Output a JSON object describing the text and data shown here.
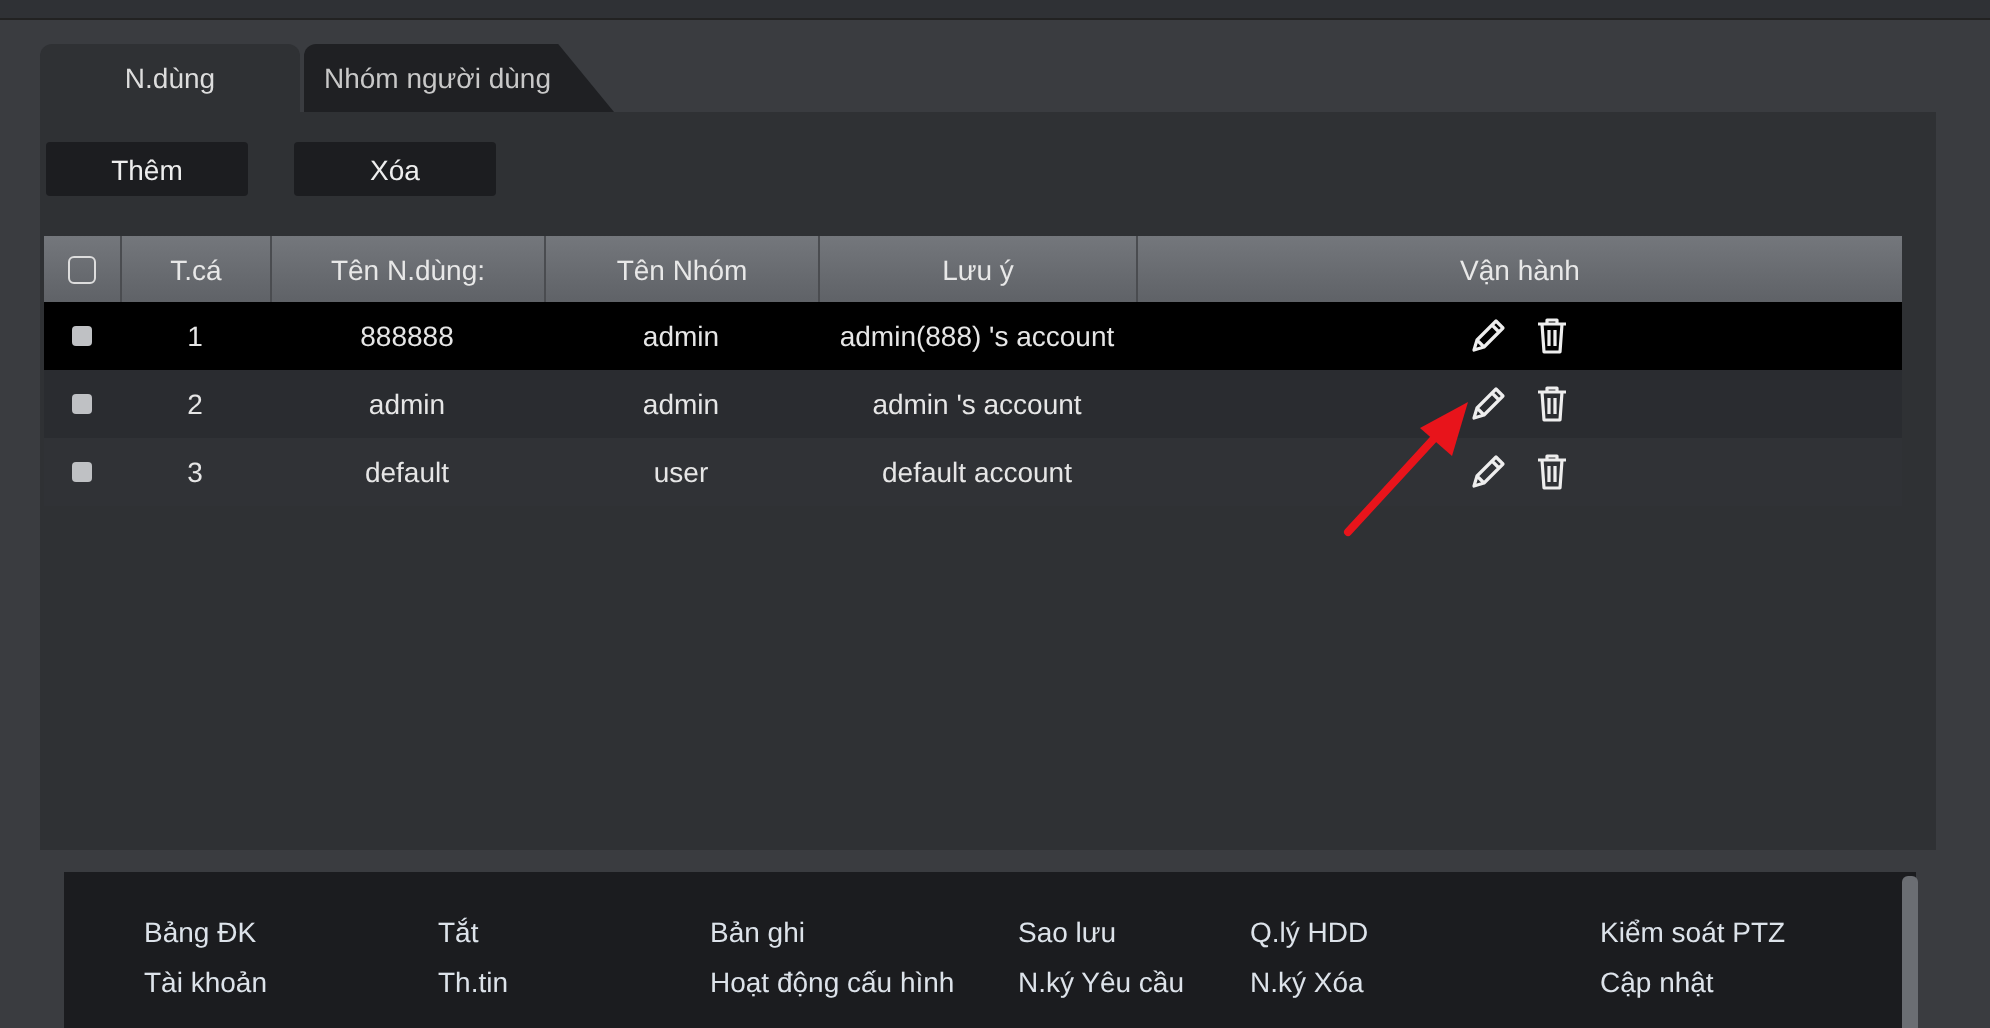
{
  "tabs": [
    {
      "label": "N.dùng",
      "selected": true
    },
    {
      "label": "Nhóm người dùng",
      "selected": false
    }
  ],
  "buttons": [
    "Thêm",
    "Xóa"
  ],
  "table": {
    "select_all": {
      "checked": false
    },
    "columns": [
      "T.cá",
      "Tên N.dùng:",
      "Tên Nhóm",
      "Lưu ý",
      "Vận hành"
    ],
    "rows": [
      {
        "checked": false,
        "selected": true,
        "cells": [
          "1",
          "888888",
          "admin",
          "admin(888) 's account"
        ]
      },
      {
        "checked": false,
        "selected": false,
        "cells": [
          "2",
          "admin",
          "admin",
          "admin 's account"
        ]
      },
      {
        "checked": false,
        "selected": false,
        "cells": [
          "3",
          "default",
          "user",
          "default account"
        ]
      }
    ]
  },
  "annotation": {
    "kind": "arrow"
  },
  "menu": [
    [
      "Bảng ĐK",
      "Tài khoản"
    ],
    [
      "Tắt",
      "Th.tin"
    ],
    [
      "Bản ghi",
      "Hoạt động cấu hình"
    ],
    [
      "Sao lưu",
      "N.ký Yêu cầu"
    ],
    [
      "Q.lý HDD",
      "N.ký Xóa"
    ],
    [
      "Kiểm soát PTZ",
      "Cập nhật"
    ]
  ]
}
